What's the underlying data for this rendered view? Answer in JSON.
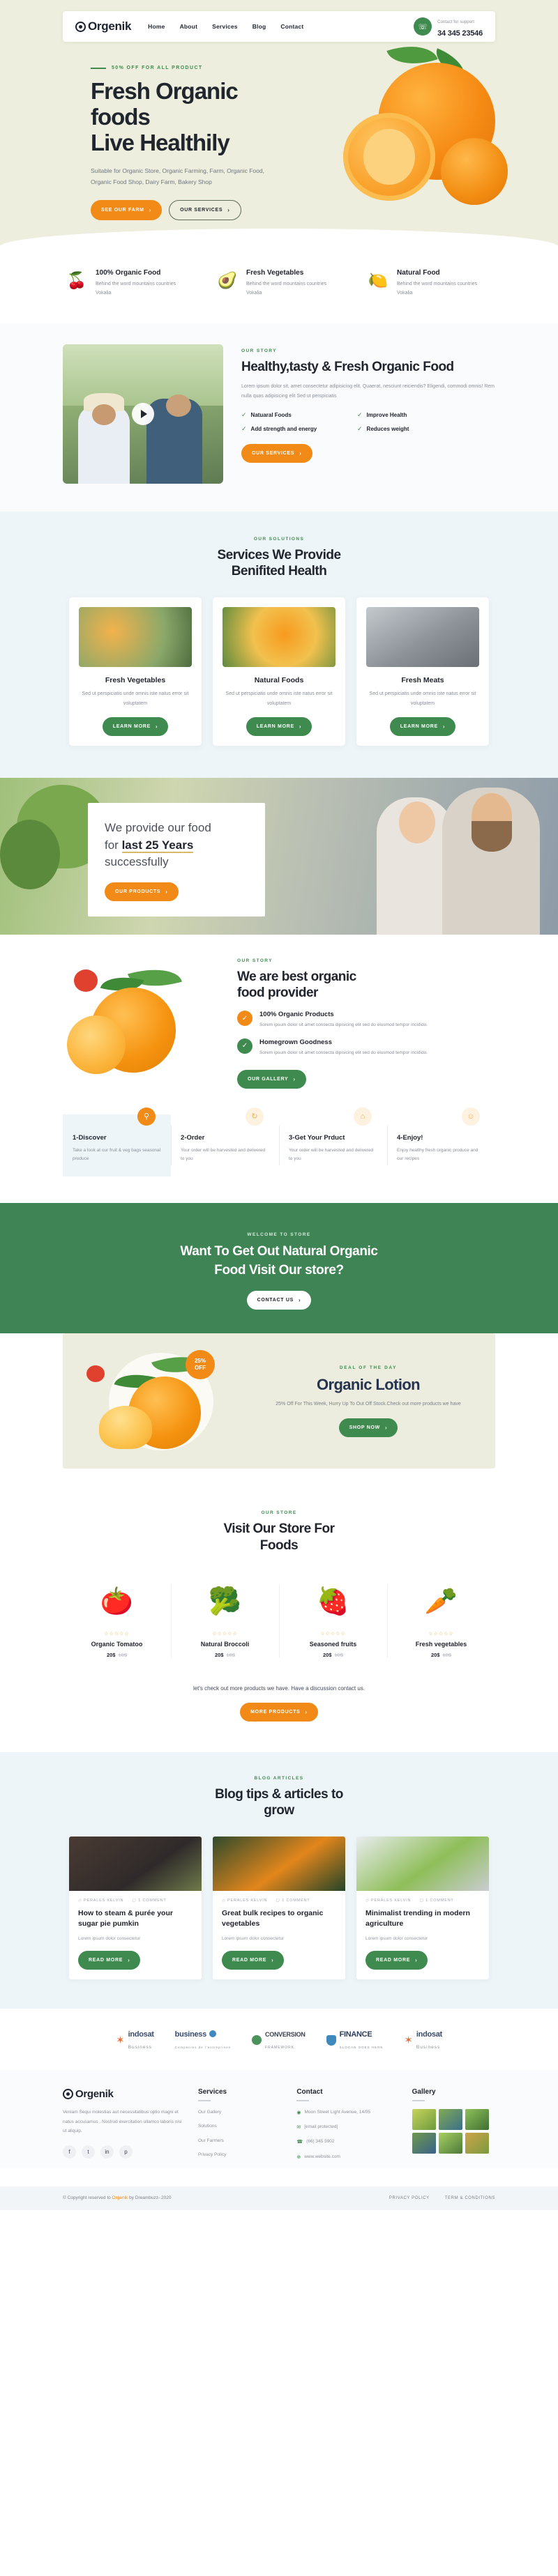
{
  "header": {
    "brand": "Orgenik",
    "nav": [
      "Home",
      "About",
      "Services",
      "Blog",
      "Contact"
    ],
    "support_label": "Contact for support",
    "phone": "34 345 23546"
  },
  "hero": {
    "eyebrow": "50% OFF FOR ALL PRODUCT",
    "title_line1": "Fresh Organic foods",
    "title_line2": "Live Healthily",
    "subtitle": "Suitable for Organic Store, Organic Farming, Farm, Organic Food, Organic Food Shop, Dairy Farm, Bakery Shop",
    "btn_primary": "SEE OUR FARM",
    "btn_secondary": "OUR SERVICES"
  },
  "features": [
    {
      "icon": "cherries-icon",
      "glyph": "🍒",
      "title": "100% Organic Food",
      "text": "Behind the word mountains countries Vokalia"
    },
    {
      "icon": "vegetables-icon",
      "glyph": "🥑",
      "title": "Fresh Vegetables",
      "text": "Behind the word mountains countries Vokalia"
    },
    {
      "icon": "lemon-icon",
      "glyph": "🍋",
      "title": "Natural Food",
      "text": "Behind the word mountains countries Vokalia"
    }
  ],
  "about": {
    "eyebrow": "OUR STORY",
    "title": "Healthy,tasty & Fresh Organic Food",
    "paragraph": "Lorem ipsum dolor sit, amet consectetur adipisicing elit. Quaerat, nesciunt reiciendis? Eligendi, commodi omnis! Rem nulla quas adipisicing elit Sed ut perspiciatis",
    "checks": [
      "Natuaral Foods",
      "Improve Health",
      "Add strength and energy",
      "Reduces weight"
    ],
    "button": "OUR SERVICES"
  },
  "services": {
    "eyebrow": "OUR SOLUTIONS",
    "title_line1": "Services We Provide",
    "title_line2": "Benifited Health",
    "cards": [
      {
        "title": "Fresh Vegetables",
        "text": "Sed ut perspiciatis unde omnis iste natus error sit voluptatem",
        "button": "LEARN MORE"
      },
      {
        "title": "Natural Foods",
        "text": "Sed ut perspiciatis unde omnis iste natus error sit voluptatem",
        "button": "LEARN MORE"
      },
      {
        "title": "Fresh Meats",
        "text": "Sed ut perspiciatis unde omnis iste natus error sit voluptatem",
        "button": "LEARN MORE"
      }
    ]
  },
  "years": {
    "line1": "We provide our food",
    "line2_prefix": "for ",
    "line2_bold": "last 25 Years",
    "line3": "successfully",
    "button": "OUR PRODUCTS"
  },
  "provider": {
    "eyebrow": "OUR STORY",
    "title_line1": "We are best organic",
    "title_line2": "food provider",
    "bullets": [
      {
        "title": "100% Organic Products",
        "text": "Sorem ipsum dolor sit amet consecta dipisicing elit sed do eiusmod tempor incidido."
      },
      {
        "title": "Homegrown Goodness",
        "text": "Sorem ipsum dolor sit amet consecta dipisicing elit sed do eiusmod tempor incidido."
      }
    ],
    "button": "OUR GALLERY"
  },
  "steps": [
    {
      "icon": "search-icon",
      "glyph": "⚲",
      "title": "1-Discover",
      "text": "Take a look at our fruit & veg bags seasonal produce"
    },
    {
      "icon": "refresh-icon",
      "glyph": "↻",
      "title": "2-Order",
      "text": "Your order will be harvested and delivered to you"
    },
    {
      "icon": "bag-icon",
      "glyph": "⌂",
      "title": "3-Get Your Prduct",
      "text": "Your order will be harvested and delivered to you"
    },
    {
      "icon": "smile-icon",
      "glyph": "☺",
      "title": "4-Enjoy!",
      "text": "Enjoy healthy fresh organic produce and our recipes"
    }
  ],
  "green_cta": {
    "eyebrow": "WELCOME TO STORE",
    "title_line1": "Want To Get Out Natural Organic",
    "title_line2": "Food Visit Our store?",
    "button": "CONTACT US"
  },
  "deal": {
    "badge_pct": "25%",
    "badge_off": "OFF",
    "eyebrow": "DEAL OF THE DAY",
    "title": "Organic Lotion",
    "text": "25% Off For This Week, Hurry Up To Out Off Stock.Check out more products we have",
    "button": "SHOP NOW"
  },
  "store": {
    "eyebrow": "OUR STORE",
    "title_line1": "Visit Our Store For",
    "title_line2": "Foods",
    "products": [
      {
        "glyph": "🍅",
        "stars": "☆☆☆☆☆",
        "name": "Organic Tomatoo",
        "price": "20$",
        "old_price": "10$"
      },
      {
        "glyph": "🥦",
        "stars": "☆☆☆☆☆",
        "name": "Natural Broccoli",
        "price": "20$",
        "old_price": "10$"
      },
      {
        "glyph": "🍓",
        "stars": "☆☆☆☆☆",
        "name": "Seasoned fruits",
        "price": "20$",
        "old_price": "10$"
      },
      {
        "glyph": "🥕",
        "stars": "☆☆☆☆☆",
        "name": "Fresh vegetables",
        "price": "20$",
        "old_price": "10$"
      }
    ],
    "note": "let's check out more products we have. Have a discussion contact us.",
    "button": "MORE PRODUCTS"
  },
  "blog": {
    "eyebrow": "BLOG ARTICLES",
    "title_line1": "Blog tips & articles to",
    "title_line2": "grow",
    "posts": [
      {
        "author": "PERALES KELVIN",
        "comments": "1 COMMENT",
        "title": "How to steam & purée your sugar pie pumkin",
        "text": "Lorem ipsum dolor consectetur",
        "button": "READ MORE"
      },
      {
        "author": "PERALES KELVIN",
        "comments": "1 COMMENT",
        "title": "Great bulk recipes to organic vegetables",
        "text": "Lorem ipsum dolor consectetur",
        "button": "READ MORE"
      },
      {
        "author": "PERALES KELVIN",
        "comments": "1 COMMENT",
        "title": "Minimalist trending in modern agriculture",
        "text": "Lorem ipsum dolor consectetur",
        "button": "READ MORE"
      }
    ]
  },
  "partners": [
    {
      "name": "indosat",
      "sub": "Business"
    },
    {
      "name": "business",
      "sub": "Companies de l'entreprises"
    },
    {
      "name": "CONVERSION",
      "sub": "FRAMEWORK"
    },
    {
      "name": "FINANCE",
      "sub": "SLOGAN GOES HERE"
    },
    {
      "name": "indosat",
      "sub": "Business"
    }
  ],
  "footer": {
    "brand": "Orgenik",
    "about": "Veniam Sequi molestias aut necessitatibus optio magni et natus accusamus . Nostrud exercitation ullamco laboris nisi ut aliquip.",
    "socials": [
      "f",
      "t",
      "in",
      "p"
    ],
    "services_title": "Services",
    "services": [
      "Our Gallery",
      "Solutions",
      "Our Farmers",
      "Privacy Policy"
    ],
    "contact_title": "Contact",
    "contact": [
      {
        "icon": "location-icon",
        "glyph": "◉",
        "text": "Moon Street Light Avenue, 14/05"
      },
      {
        "icon": "email-icon",
        "glyph": "✉",
        "text": "[email protected]"
      },
      {
        "icon": "phone-icon",
        "glyph": "☎",
        "text": "(66) 345 5902"
      },
      {
        "icon": "globe-icon",
        "glyph": "⊕",
        "text": "www.website.com"
      }
    ],
    "gallery_title": "Gallery",
    "copyright_pre": "© Copyright reserved to ",
    "copyright_brand": "Orgenik",
    "copyright_post": " by Dreambuzz- 2020",
    "links": [
      "PRIVACY POLICY",
      "TERM & CONDITIONS"
    ]
  }
}
